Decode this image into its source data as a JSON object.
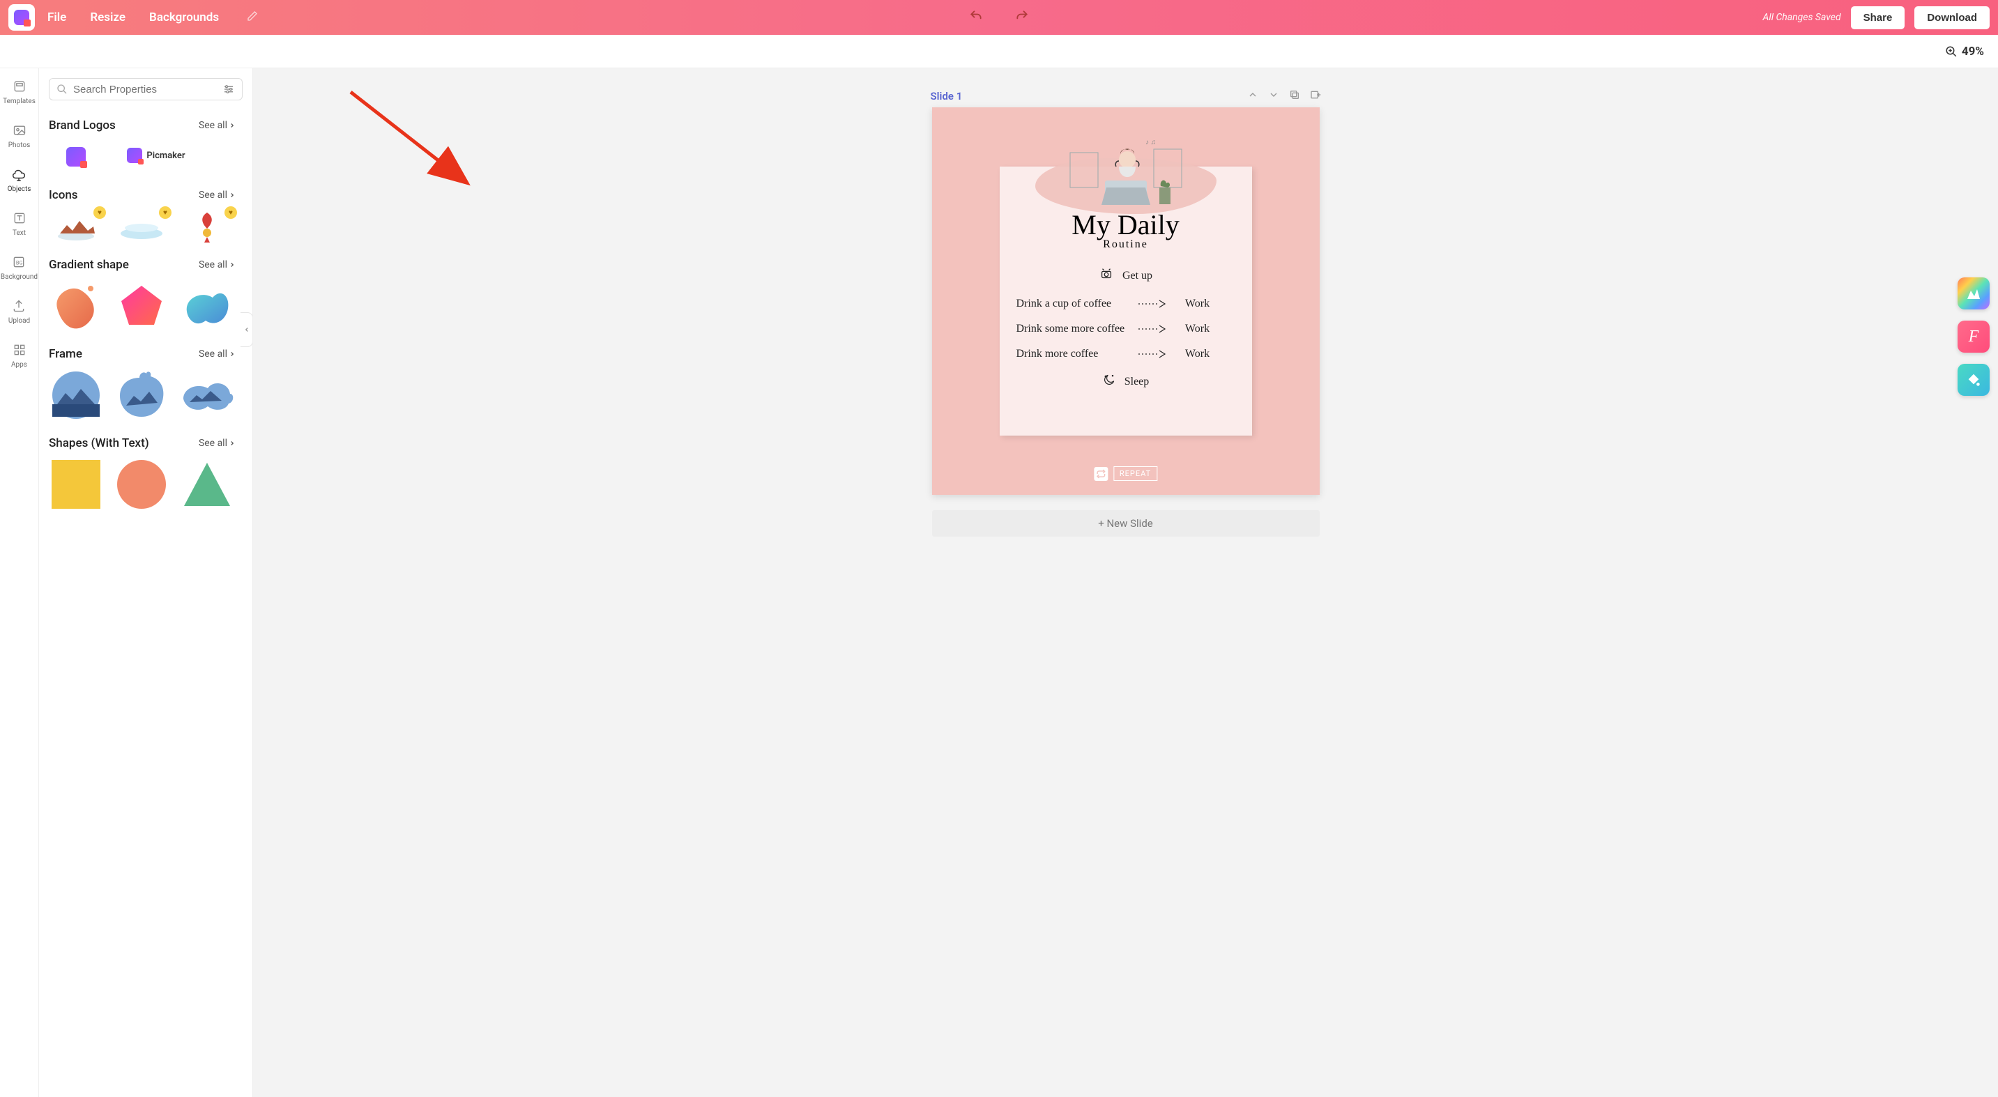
{
  "header": {
    "menu": {
      "file": "File",
      "resize": "Resize",
      "backgrounds": "Backgrounds"
    },
    "saved_label": "All Changes Saved",
    "share": "Share",
    "download": "Download"
  },
  "zoom": {
    "value": "49%"
  },
  "rail": {
    "templates": "Templates",
    "photos": "Photos",
    "objects": "Objects",
    "text": "Text",
    "background": "Background",
    "upload": "Upload",
    "apps": "Apps"
  },
  "panel": {
    "search_placeholder": "Search Properties",
    "see_all": "See all",
    "sections": {
      "brand_logos": "Brand Logos",
      "icons": "Icons",
      "gradient_shape": "Gradient shape",
      "frame": "Frame",
      "shapes_with_text": "Shapes (With Text)"
    },
    "brand_item": "Picmaker"
  },
  "canvas": {
    "slide_label": "Slide 1",
    "new_slide": "+ New Slide",
    "repeat": "REPEAT",
    "card": {
      "title": "My Daily",
      "subtitle": "Routine",
      "rows": {
        "getup": "Get up",
        "r1a": "Drink a cup of coffee",
        "r1b": "Work",
        "r2a": "Drink some more coffee",
        "r2b": "Work",
        "r3a": "Drink more coffee",
        "r3b": "Work",
        "sleep": "Sleep"
      }
    }
  }
}
